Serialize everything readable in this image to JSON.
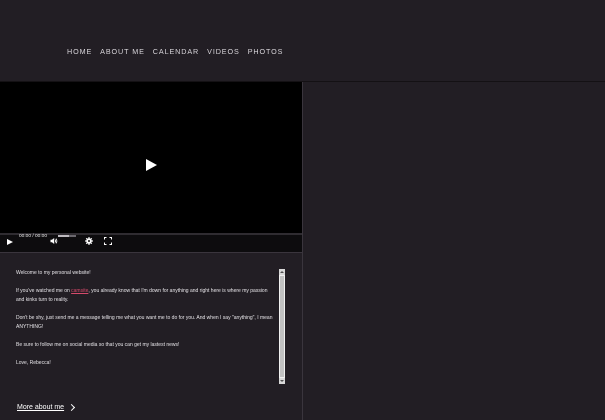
{
  "nav": {
    "items": [
      "HOME",
      "ABOUT ME",
      "CALENDAR",
      "VIDEOS",
      "PHOTOS"
    ]
  },
  "player": {
    "time": "00:00 / 00:00",
    "volume_fraction": 0.6,
    "icons": [
      "play-icon",
      "volume-icon",
      "gear-icon",
      "fullscreen-icon"
    ]
  },
  "about": {
    "greeting": "Welcome to my personal website!",
    "p2_before": "If you've watched me on ",
    "p2_link": "camsite",
    "p2_after": ", you already know that I'm down for anything and right here is where my passion and kinks turn to reality.",
    "p3": "Don't be shy, just send me a message telling me what you want me to do for you. And when I say \"anything\", I mean ANYTHING!",
    "p4": "Be sure to follow me on social media so that you can get my lastest news!",
    "signoff": "Love, Rebecca!",
    "more_label": "More about me"
  },
  "colors": {
    "background": "#221e24",
    "link": "#d64a6b",
    "video": "#000000"
  }
}
